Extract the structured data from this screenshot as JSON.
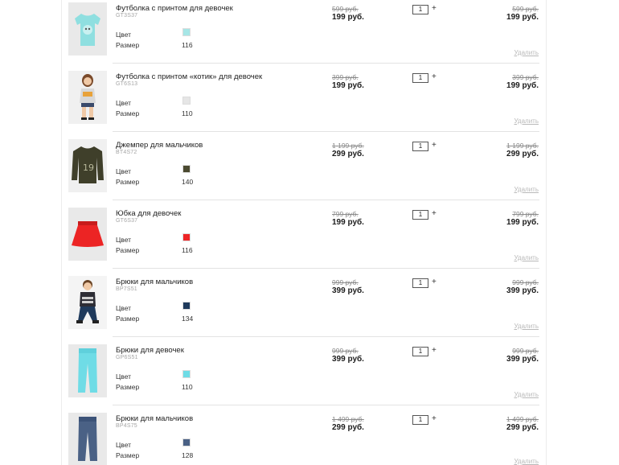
{
  "cart": {
    "color_label": "Цвет",
    "size_label": "Размер",
    "delete_label": "Удалить",
    "plus_label": "+",
    "items": [
      {
        "name": "Футболка с принтом для девочек",
        "sku": "GT3S37",
        "color": "#a6e6e6",
        "size": "116",
        "old_price": "599 руб.",
        "price": "199 руб.",
        "qty": "1",
        "old_total": "599 руб.",
        "total": "199 руб.",
        "icon": "tshirt-girl-icon"
      },
      {
        "name": "Футболка с принтом «котик» для девочек",
        "sku": "GT6S13",
        "color": "#e6e6e6",
        "size": "110",
        "old_price": "399 руб.",
        "price": "199 руб.",
        "qty": "1",
        "old_total": "399 руб.",
        "total": "199 руб.",
        "icon": "girl-model-icon"
      },
      {
        "name": "Джемпер для мальчиков",
        "sku": "BT4S72",
        "color": "#4b4a30",
        "size": "140",
        "old_price": "1 199 руб.",
        "price": "299 руб.",
        "qty": "1",
        "old_total": "1 199 руб.",
        "total": "299 руб.",
        "icon": "jumper-icon"
      },
      {
        "name": "Юбка для девочек",
        "sku": "GT6S37",
        "color": "#ee2526",
        "size": "116",
        "old_price": "799 руб.",
        "price": "199 руб.",
        "qty": "1",
        "old_total": "799 руб.",
        "total": "199 руб.",
        "icon": "skirt-icon"
      },
      {
        "name": "Брюки для мальчиков",
        "sku": "BP7S51",
        "color": "#1f3a5c",
        "size": "134",
        "old_price": "999 руб.",
        "price": "399 руб.",
        "qty": "1",
        "old_total": "999 руб.",
        "total": "399 руб.",
        "icon": "boy-model-icon"
      },
      {
        "name": "Брюки для девочек",
        "sku": "GP6S51",
        "color": "#6fdce6",
        "size": "110",
        "old_price": "999 руб.",
        "price": "399 руб.",
        "qty": "1",
        "old_total": "999 руб.",
        "total": "399 руб.",
        "icon": "pants-girl-icon"
      },
      {
        "name": "Брюки для мальчиков",
        "sku": "BP4S75",
        "color": "#4a6185",
        "size": "128",
        "old_price": "1 499 руб.",
        "price": "299 руб.",
        "qty": "1",
        "old_total": "1 499 руб.",
        "total": "299 руб.",
        "icon": "jeans-boy-icon"
      }
    ]
  }
}
